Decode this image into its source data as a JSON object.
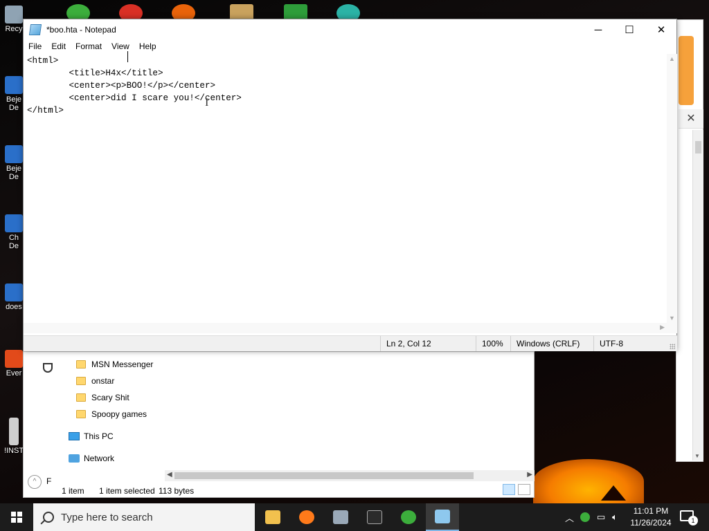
{
  "desktop": {
    "icons": [
      {
        "label": "Recy",
        "color": "#8fa3b3"
      },
      {
        "label": "Beje",
        "label2": "De",
        "color": "#2a6fc9"
      },
      {
        "label": "Beje",
        "label2": "De",
        "color": "#2a6fc9"
      },
      {
        "label": "Ch",
        "label2": "De",
        "color": "#2a6fc9"
      },
      {
        "label": "does",
        "color": "#2a6fc9"
      },
      {
        "label": "Ever",
        "color": "#e24a1a"
      },
      {
        "label": "!INST",
        "color": "#cfcfcf"
      }
    ]
  },
  "notepad": {
    "title": "*boo.hta - Notepad",
    "controls": {
      "minimize": "─",
      "maximize": "☐",
      "close": "✕"
    },
    "menu": [
      "File",
      "Edit",
      "Format",
      "View",
      "Help"
    ],
    "content": "<html>\n\t<title>H4x</title>\n\t<center><p>BOO!</p></center>\n\t<center>did I scare you!</center>\n</html>",
    "status": {
      "position": "Ln 2, Col 12",
      "zoom": "100%",
      "line_ending": "Windows (CRLF)",
      "encoding": "UTF-8"
    }
  },
  "explorer": {
    "folders": [
      "MSN Messenger",
      "onstar",
      "Scary Shit",
      "Spoopy games"
    ],
    "this_pc": "This PC",
    "network": "Network",
    "left_fragment": "F",
    "status": {
      "items": "1 item",
      "selected": "1 item selected",
      "size": "113 bytes"
    }
  },
  "background_window": {
    "close": "✕"
  },
  "taskbar": {
    "search_placeholder": "Type here to search",
    "apps": [
      {
        "name": "file-explorer",
        "color": "#f2c14e"
      },
      {
        "name": "firefox",
        "color": "#ff7a1a"
      },
      {
        "name": "control-panel",
        "color": "#9aa9b8"
      },
      {
        "name": "command-prompt",
        "color": "#2b2b2b"
      },
      {
        "name": "msn-messenger",
        "color": "#3cae3c"
      },
      {
        "name": "notepad",
        "color": "#8ec8ee"
      }
    ],
    "clock_time": "11:01 PM",
    "clock_date": "11/26/2024",
    "notification_count": "1"
  }
}
